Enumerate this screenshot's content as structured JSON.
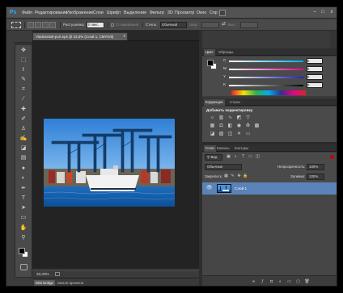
{
  "app": {
    "logo": "Ps"
  },
  "menu": {
    "items": [
      "Файл",
      "Редактирование",
      "Изображение",
      "Слои",
      "Шрифт",
      "Выделение",
      "Фильтр",
      "3D",
      "Просмотр",
      "Окно",
      "Спр"
    ]
  },
  "window_controls": {
    "minimize": "–",
    "maximize": "□",
    "close": "x"
  },
  "options_bar": {
    "feather_label": "Растушевка:",
    "feather_value": "0 пикс.",
    "antialias_label": "Сглаживание",
    "style_label": "Стиль:",
    "style_value": "Обычный",
    "width_label": "Шир.:",
    "height_label": "Выс.:"
  },
  "document": {
    "tab_title": "Vladivostok-port.eps @ 33,3% (Слой 1, CMYK/8)",
    "tab_close": "x",
    "zoom": "33,33%"
  },
  "bottom_tabs": {
    "mini_bridge": "Mini Bridge",
    "timeline": "Шкала времени"
  },
  "color_panel": {
    "tabs": [
      "Цвет",
      "Образцы"
    ],
    "channels": [
      {
        "label": "C",
        "value": "0",
        "color": "#00b8f0"
      },
      {
        "label": "M",
        "value": "0",
        "color": "#e8007e"
      },
      {
        "label": "Y",
        "value": "0",
        "color": "#f5e400"
      },
      {
        "label": "K",
        "value": "0",
        "color": "#1a1a1a"
      }
    ]
  },
  "adjustments_panel": {
    "tabs": [
      "Коррекция",
      "Стили"
    ],
    "heading": "Добавить корректировку",
    "icons_row1": [
      "brightness-icon",
      "levels-icon",
      "curves-icon",
      "exposure-icon",
      "vibrance-icon"
    ],
    "icons_row2": [
      "hue-saturation-icon",
      "color-balance-icon",
      "black-white-icon",
      "photo-filter-icon",
      "channel-mixer-icon",
      "color-lookup-icon"
    ],
    "icons_row3": [
      "invert-icon",
      "posterize-icon",
      "threshold-icon",
      "selective-color-icon",
      "gradient-map-icon"
    ]
  },
  "layers_panel": {
    "tabs": [
      "Слои",
      "Каналы",
      "Контуры"
    ],
    "filter_label": "Вид",
    "blend_mode": "Обычные",
    "opacity_label": "Непрозрачность:",
    "opacity_value": "100%",
    "lock_label": "Закрепить:",
    "fill_label": "Заливка:",
    "fill_value": "100%",
    "layers": [
      {
        "name": "Слой 1",
        "visible": true,
        "selected": true
      }
    ],
    "footer_icons": [
      "link-icon",
      "fx-icon",
      "mask-icon",
      "adjustment-layer-icon",
      "group-icon",
      "new-layer-icon",
      "trash-icon"
    ]
  },
  "toolbox": {
    "tools": [
      "move-tool-icon",
      "marquee-tool-icon",
      "lasso-tool-icon",
      "quick-select-tool-icon",
      "crop-tool-icon",
      "eyedropper-tool-icon",
      "healing-tool-icon",
      "brush-tool-icon",
      "clone-stamp-tool-icon",
      "history-brush-tool-icon",
      "eraser-tool-icon",
      "gradient-tool-icon",
      "blur-tool-icon",
      "dodge-tool-icon",
      "pen-tool-icon",
      "type-tool-icon",
      "path-select-tool-icon",
      "shape-tool-icon",
      "hand-tool-icon",
      "zoom-tool-icon"
    ],
    "foreground_color": "#000000",
    "background_color": "#ffffff"
  }
}
